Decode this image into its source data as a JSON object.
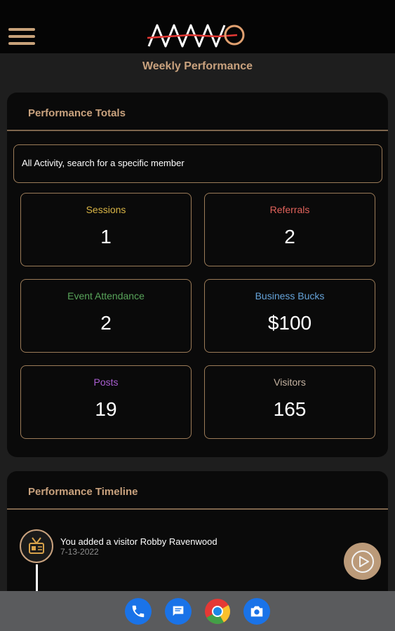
{
  "header": {
    "title": "Weekly Performance"
  },
  "totals": {
    "title": "Performance Totals",
    "search_text": "All Activity, search for a specific member",
    "stats": [
      {
        "label": "Sessions",
        "value": "1",
        "color": "#d8b446"
      },
      {
        "label": "Referrals",
        "value": "2",
        "color": "#e0625b"
      },
      {
        "label": "Event Attendance",
        "value": "2",
        "color": "#58a45a"
      },
      {
        "label": "Business Bucks",
        "value": "$100",
        "color": "#65a3d9"
      },
      {
        "label": "Posts",
        "value": "19",
        "color": "#a95ed1"
      },
      {
        "label": "Visitors",
        "value": "165",
        "color": "#c5b3a1"
      }
    ]
  },
  "timeline": {
    "title": "Performance Timeline",
    "items": [
      {
        "text": "You added a visitor Robby Ravenwood",
        "date": "7-13-2022",
        "icon": "visitor-badge-icon"
      }
    ]
  },
  "dock": [
    {
      "name": "phone",
      "icon": "phone-icon",
      "color": "#1a73e8"
    },
    {
      "name": "messages",
      "icon": "messages-icon",
      "color": "#1a73e8"
    },
    {
      "name": "chrome",
      "icon": "chrome-icon",
      "color": "#e53935"
    },
    {
      "name": "camera",
      "icon": "camera-icon",
      "color": "#1a73e8"
    }
  ],
  "colors": {
    "accent": "#c9a27e",
    "background": "#1e1e1e",
    "card": "#0a0a0a"
  }
}
